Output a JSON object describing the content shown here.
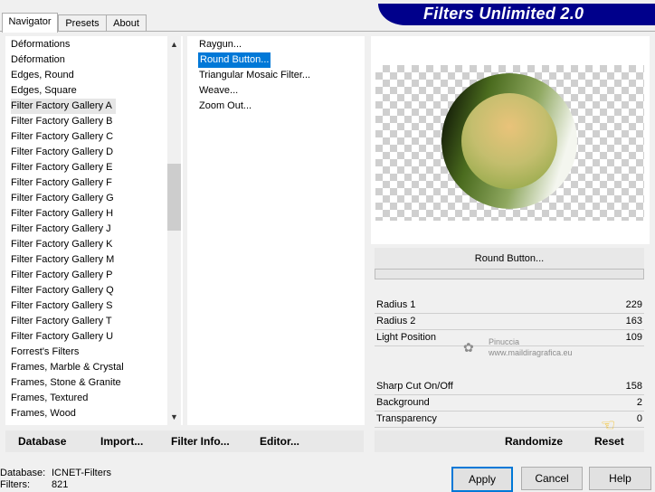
{
  "tabs": [
    "Navigator",
    "Presets",
    "About"
  ],
  "banner": "Filters Unlimited 2.0",
  "categories": [
    "Déformations",
    "Déformation",
    "Edges, Round",
    "Edges, Square",
    "Filter Factory Gallery A",
    "Filter Factory Gallery B",
    "Filter Factory Gallery C",
    "Filter Factory Gallery D",
    "Filter Factory Gallery E",
    "Filter Factory Gallery F",
    "Filter Factory Gallery G",
    "Filter Factory Gallery H",
    "Filter Factory Gallery J",
    "Filter Factory Gallery K",
    "Filter Factory Gallery M",
    "Filter Factory Gallery P",
    "Filter Factory Gallery Q",
    "Filter Factory Gallery S",
    "Filter Factory Gallery T",
    "Filter Factory Gallery U",
    "Forrest's Filters",
    "Frames, Marble & Crystal",
    "Frames, Stone & Granite",
    "Frames, Textured",
    "Frames, Wood"
  ],
  "selected_category": "Filter Factory Gallery A",
  "filters": [
    "Raygun...",
    "Round Button...",
    "Triangular Mosaic Filter...",
    "Weave...",
    "Zoom Out..."
  ],
  "selected_filter": "Round Button...",
  "filter_name": "Round Button...",
  "params": [
    {
      "label": "Radius 1",
      "value": "229"
    },
    {
      "label": "Radius 2",
      "value": "163"
    },
    {
      "label": "Light Position",
      "value": "109"
    },
    {
      "label": "Sharp Cut On/Off",
      "value": "158"
    },
    {
      "label": "Background",
      "value": "2"
    },
    {
      "label": "Transparency",
      "value": "0"
    }
  ],
  "bottom_links": {
    "database": "Database",
    "import": "Import...",
    "filter_info": "Filter Info...",
    "editor": "Editor...",
    "randomize": "Randomize",
    "reset": "Reset"
  },
  "buttons": {
    "apply": "Apply",
    "cancel": "Cancel",
    "help": "Help"
  },
  "status": {
    "database_label": "Database:",
    "database_value": "ICNET-Filters",
    "filters_label": "Filters:",
    "filters_value": "821"
  },
  "watermark": {
    "line1": "Pinuccia",
    "line2": "www.maildiragrafica.eu"
  },
  "colors": {
    "accent": "#0078d7",
    "banner_bg": "#00008b",
    "selection": "#0078d7"
  },
  "icons": [
    "scroll-up-icon",
    "scroll-down-icon",
    "pointing-hand-icon"
  ]
}
